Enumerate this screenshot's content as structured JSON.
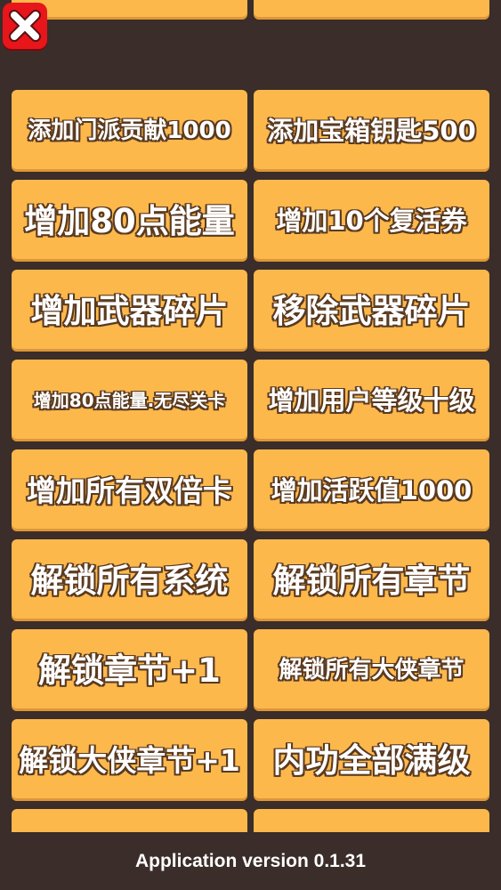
{
  "close_button": {
    "icon": "close-x-icon",
    "color": "#e8151b"
  },
  "cheats": [
    {
      "label": "添加门派贡献1000",
      "size": "fs-s"
    },
    {
      "label": "添加宝箱钥匙500",
      "size": "fs-m"
    },
    {
      "label": "增加80点能量",
      "size": "fs-xl"
    },
    {
      "label": "增加10个复活券",
      "size": "fs-m"
    },
    {
      "label": "增加武器碎片",
      "size": "fs-xl"
    },
    {
      "label": "移除武器碎片",
      "size": "fs-xl"
    },
    {
      "label": "增加80点能量.无尽关卡",
      "size": "fs-xs"
    },
    {
      "label": "增加用户等级十级",
      "size": "fs-m"
    },
    {
      "label": "增加所有双倍卡",
      "size": "fs-l"
    },
    {
      "label": "增加活跃值1000",
      "size": "fs-m"
    },
    {
      "label": "解锁所有系统",
      "size": "fs-xl"
    },
    {
      "label": "解锁所有章节",
      "size": "fs-xl"
    },
    {
      "label": "解锁章节+1",
      "size": "fs-xl"
    },
    {
      "label": "解锁所有大侠章节",
      "size": "fs-s"
    },
    {
      "label": "解锁大侠章节+1",
      "size": "fs-l"
    },
    {
      "label": "内功全部满级",
      "size": "fs-xl"
    }
  ],
  "colors": {
    "background": "#3a2d2a",
    "button": "#fdb84c",
    "text_outline": "#5a3a20"
  },
  "footer": {
    "version_text": "Application version 0.1.31"
  }
}
